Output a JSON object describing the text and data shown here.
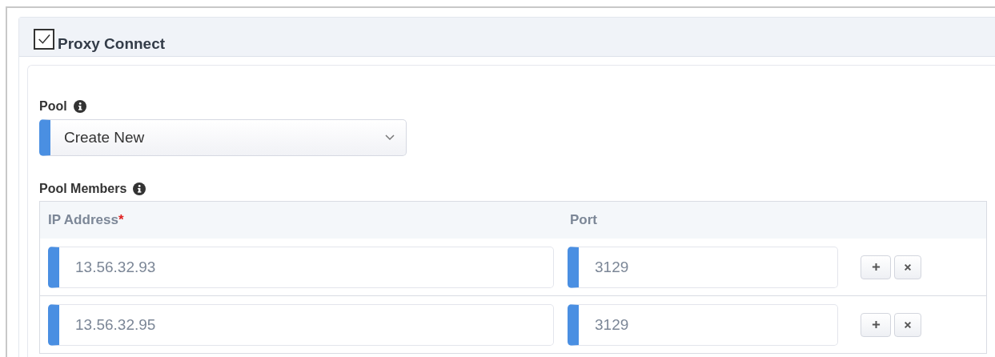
{
  "panel": {
    "title": "Proxy Connect",
    "checked": true
  },
  "pool": {
    "label": "Pool",
    "value": "Create New"
  },
  "members": {
    "label": "Pool Members",
    "columns": [
      {
        "label": "IP Address",
        "required": true
      },
      {
        "label": "Port",
        "required": false
      }
    ],
    "rows": [
      {
        "ip": "13.56.32.93",
        "port": "3129"
      },
      {
        "ip": "13.56.32.95",
        "port": "3129"
      }
    ]
  },
  "required_mark": "*"
}
